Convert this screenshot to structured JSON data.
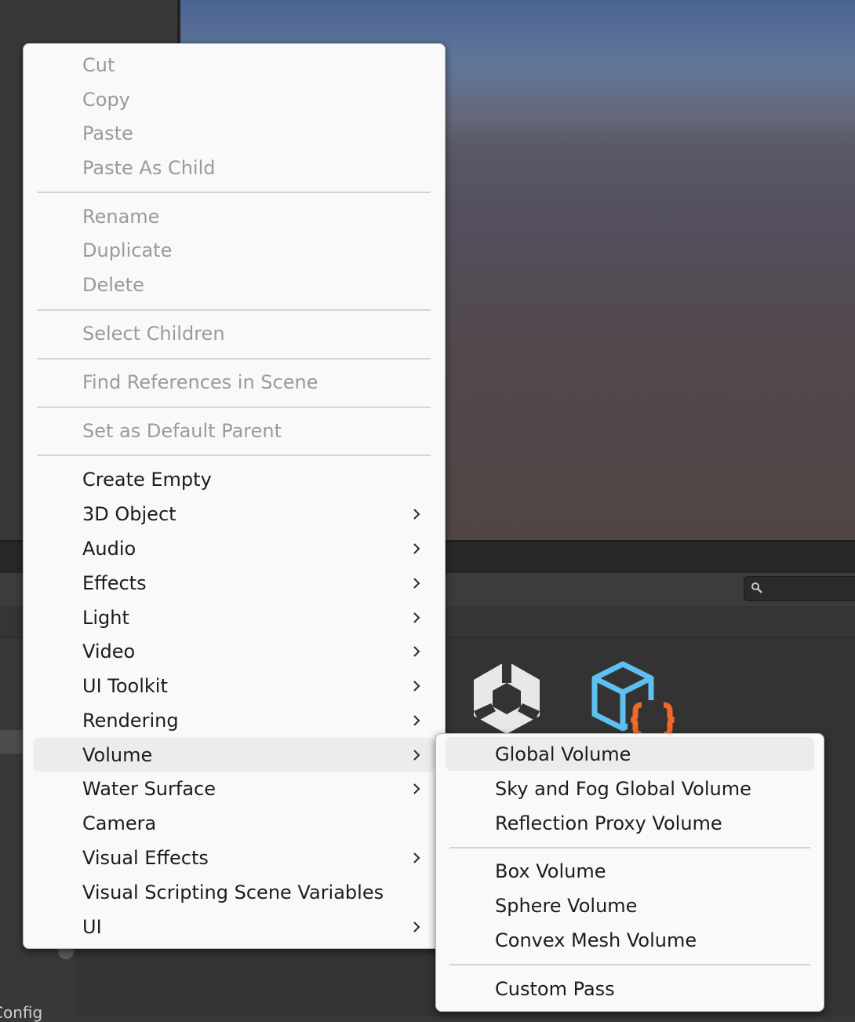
{
  "colors": {
    "menu_bg": "#f9f9f9",
    "menu_text": "#1c1c1c",
    "menu_text_disabled": "#9a9a9a",
    "hover_bg": "#ececec",
    "editor_bg": "#383838",
    "script_icon_blue": "#5ec0f0",
    "script_icon_orange": "#f0682a"
  },
  "background": {
    "config_label": "Config",
    "search": {
      "placeholder": ""
    }
  },
  "context_menu": {
    "clipboard": [
      "Cut",
      "Copy",
      "Paste",
      "Paste As Child"
    ],
    "edit": [
      "Rename",
      "Duplicate",
      "Delete"
    ],
    "select_children": "Select Children",
    "find_references": "Find References in Scene",
    "set_default_parent": "Set as Default Parent",
    "create_items": [
      {
        "label": "Create Empty",
        "submenu": false
      },
      {
        "label": "3D Object",
        "submenu": true
      },
      {
        "label": "Audio",
        "submenu": true
      },
      {
        "label": "Effects",
        "submenu": true
      },
      {
        "label": "Light",
        "submenu": true
      },
      {
        "label": "Video",
        "submenu": true
      },
      {
        "label": "UI Toolkit",
        "submenu": true
      },
      {
        "label": "Rendering",
        "submenu": true
      },
      {
        "label": "Volume",
        "submenu": true,
        "hovered": true
      },
      {
        "label": "Water Surface",
        "submenu": true
      },
      {
        "label": "Camera",
        "submenu": false
      },
      {
        "label": "Visual Effects",
        "submenu": true
      },
      {
        "label": "Visual Scripting Scene Variables",
        "submenu": false
      },
      {
        "label": "UI",
        "submenu": true
      }
    ]
  },
  "volume_submenu": {
    "global_group": [
      "Global Volume",
      "Sky and Fog Global Volume",
      "Reflection Proxy Volume"
    ],
    "local_group": [
      "Box Volume",
      "Sphere Volume",
      "Convex Mesh Volume"
    ],
    "custom_group": [
      "Custom Pass"
    ],
    "hovered": "Global Volume"
  }
}
